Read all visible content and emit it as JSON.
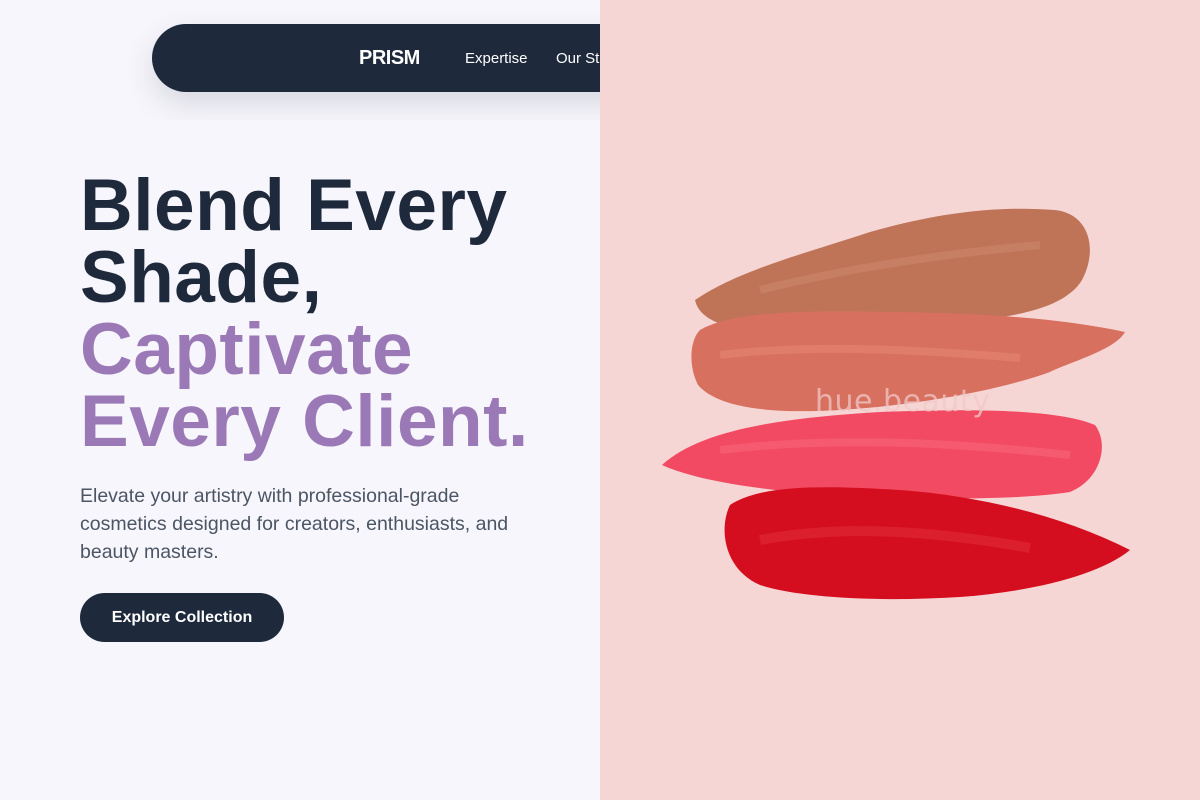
{
  "nav": {
    "brand": "PRISM",
    "links": [
      "Expertise",
      "Our Story"
    ]
  },
  "hero": {
    "headline_line1": "Blend Every",
    "headline_line2": "Shade,",
    "headline_line3": "Captivate",
    "headline_line4": "Every Client.",
    "subtitle": "Elevate your artistry with professional-grade cosmetics designed for creators, enthusiasts, and beauty masters.",
    "cta_label": "Explore Collection"
  },
  "image": {
    "watermark": "hue.beauty",
    "swatches": [
      "nude-brown",
      "coral",
      "pink",
      "red"
    ]
  },
  "colors": {
    "navy": "#1e293b",
    "accent_purple": "#9b79b6",
    "panel_pink": "#f6d6d4",
    "swatch_nude": "#bf7458",
    "swatch_coral": "#d8705f",
    "swatch_pink": "#f24a62",
    "swatch_red": "#d40e1e"
  }
}
